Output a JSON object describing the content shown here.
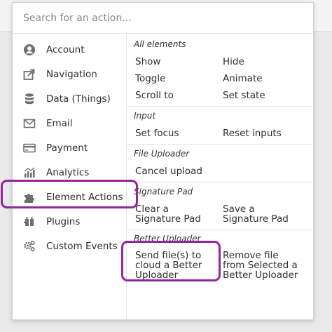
{
  "search": {
    "placeholder": "Search for an action..."
  },
  "categories": [
    {
      "label": "Account",
      "icon": "account-icon"
    },
    {
      "label": "Navigation",
      "icon": "navigation-icon"
    },
    {
      "label": "Data (Things)",
      "icon": "database-icon"
    },
    {
      "label": "Email",
      "icon": "email-icon"
    },
    {
      "label": "Payment",
      "icon": "payment-icon"
    },
    {
      "label": "Analytics",
      "icon": "analytics-icon"
    },
    {
      "label": "Element Actions",
      "icon": "puzzle-icon"
    },
    {
      "label": "Plugins",
      "icon": "plug-icon"
    },
    {
      "label": "Custom Events",
      "icon": "gears-icon"
    }
  ],
  "sections": {
    "all_elements": {
      "title": "All elements",
      "actions": [
        "Show",
        "Hide",
        "Toggle",
        "Animate",
        "Scroll to",
        "Set state"
      ]
    },
    "input": {
      "title": "Input",
      "actions": [
        "Set focus",
        "Reset inputs"
      ]
    },
    "file_uploader": {
      "title": "File Uploader",
      "actions": [
        "Cancel upload"
      ]
    },
    "signature_pad": {
      "title": "Signature Pad",
      "actions": [
        "Clear a Signature Pad",
        "Save a Signature Pad"
      ]
    },
    "better_uploader": {
      "title": "Better Uploader",
      "actions": [
        "Send file(s) to cloud a Better Uploader",
        "Remove file from Selected a Better Uploader"
      ]
    }
  },
  "colors": {
    "highlight": "#92269b",
    "icon": "#6e6e6e"
  }
}
